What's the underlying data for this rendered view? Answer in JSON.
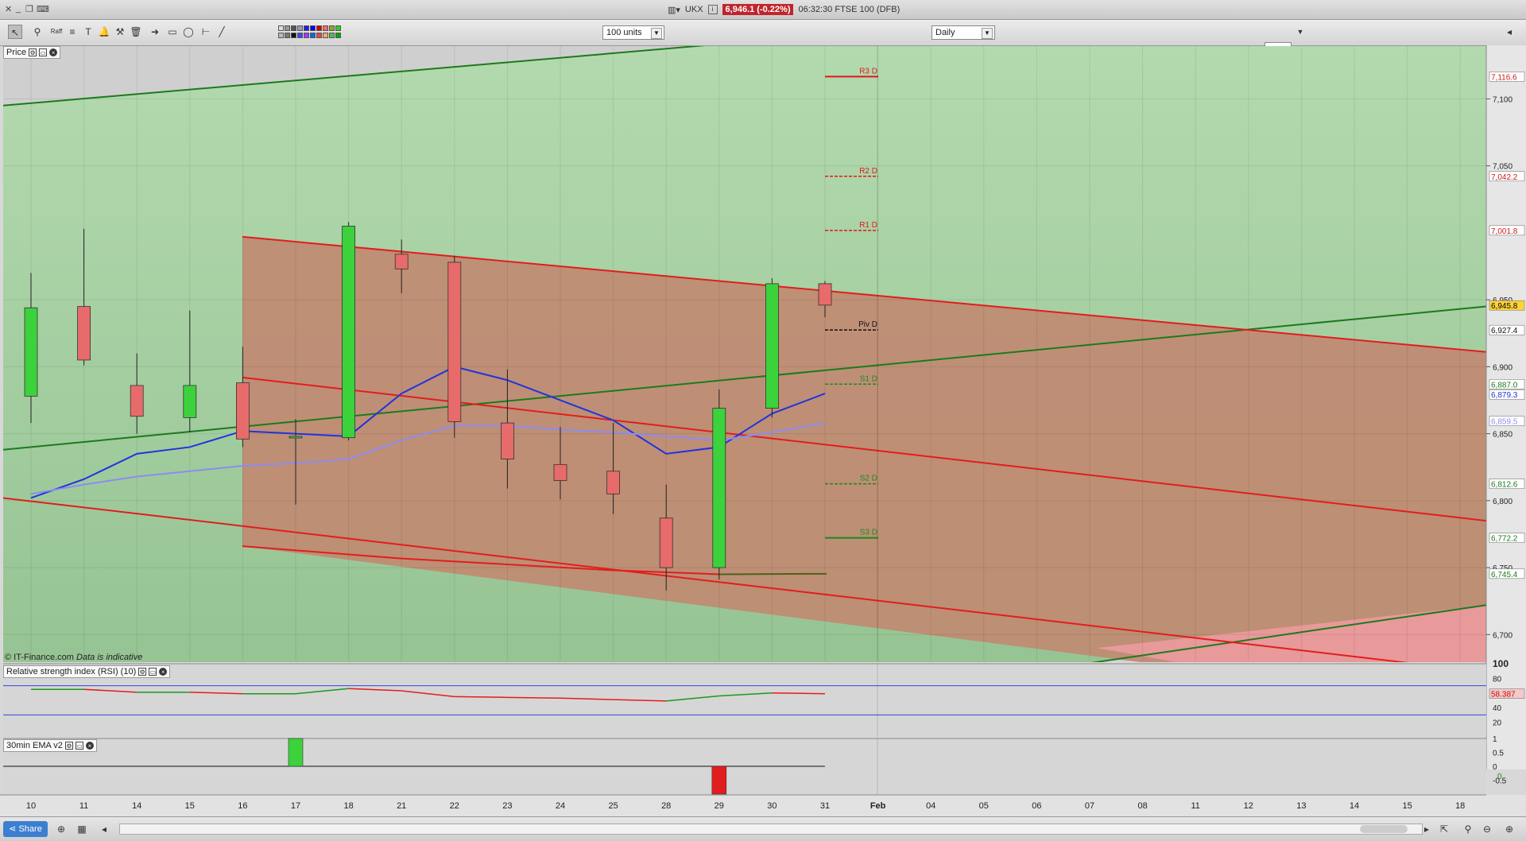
{
  "window": {
    "symbol": "UKX",
    "price_badge": "6,946.1 (-0.22%)",
    "time_label": "06:32:30 FTSE 100 (DFB)"
  },
  "toolbar": {
    "units_select": "100 units",
    "period_select": "Daily",
    "raff_label": "Raff"
  },
  "panels": {
    "price_label": "Price",
    "rsi_label": "Relative strength index (RSI) (10)",
    "ema_label": "30min EMA v2",
    "watermark_source": "© IT-Finance.com",
    "watermark_note": "Data is indicative"
  },
  "bottom": {
    "share_label": "Share"
  },
  "colors": {
    "up": "#3cd23c",
    "down": "#e86b6b",
    "channel_green": "#1c7a1c",
    "channel_red": "#e21d1d",
    "ma_fast": "#2233dd",
    "ma_slow": "#8c8cf0"
  },
  "chart_data": [
    {
      "type": "candlestick",
      "x": [
        "10",
        "11",
        "14",
        "15",
        "16",
        "17",
        "18",
        "21",
        "22",
        "23",
        "24",
        "25",
        "28",
        "29",
        "30",
        "31",
        "Feb",
        "04",
        "05",
        "06",
        "07",
        "08",
        "11",
        "12",
        "13",
        "14",
        "15",
        "18"
      ],
      "ohlc": [
        {
          "d": "10",
          "o": 6878,
          "h": 6920,
          "l": 6858,
          "c": 6944,
          "hi": 6970
        },
        {
          "d": "11",
          "o": 6945,
          "h": 7003,
          "l": 6901,
          "c": 6905
        },
        {
          "d": "14",
          "o": 6886,
          "h": 6910,
          "l": 6850,
          "c": 6863
        },
        {
          "d": "15",
          "o": 6862,
          "h": 6942,
          "l": 6851,
          "c": 6886
        },
        {
          "d": "16",
          "o": 6888,
          "h": 6915,
          "l": 6840,
          "c": 6846
        },
        {
          "d": "17",
          "o": 6848,
          "h": 6861,
          "l": 6797,
          "c": 6848
        },
        {
          "d": "18",
          "o": 6847,
          "h": 7008,
          "l": 6845,
          "c": 7005
        },
        {
          "d": "21",
          "o": 6984,
          "h": 6995,
          "l": 6955,
          "c": 6973
        },
        {
          "d": "22",
          "o": 6978,
          "h": 6983,
          "l": 6847,
          "c": 6859
        },
        {
          "d": "23",
          "o": 6858,
          "h": 6898,
          "l": 6809,
          "c": 6831
        },
        {
          "d": "24",
          "o": 6827,
          "h": 6855,
          "l": 6801,
          "c": 6815
        },
        {
          "d": "25",
          "o": 6822,
          "h": 6858,
          "l": 6790,
          "c": 6805
        },
        {
          "d": "28",
          "o": 6787,
          "h": 6812,
          "l": 6733,
          "c": 6750
        },
        {
          "d": "29",
          "o": 6750,
          "h": 6883,
          "l": 6741,
          "c": 6869
        },
        {
          "d": "30",
          "o": 6869,
          "h": 6966,
          "l": 6862,
          "c": 6962
        },
        {
          "d": "31",
          "o": 6962,
          "h": 6964,
          "l": 6937,
          "c": 6946
        }
      ],
      "ma_fast": [
        6802,
        6816,
        6835,
        6840,
        6852,
        6850,
        6848,
        6880,
        6900,
        6890,
        6875,
        6860,
        6835,
        6840,
        6865,
        6880
      ],
      "ma_slow": [
        6805,
        6812,
        6818,
        6822,
        6826,
        6828,
        6831,
        6845,
        6856,
        6856,
        6853,
        6851,
        6848,
        6845,
        6851,
        6858
      ],
      "pivots": [
        {
          "name": "R3 D",
          "value": 7116.6,
          "label": "7,116.6"
        },
        {
          "name": "R2 D",
          "value": 7042.2,
          "label": "7,042.2"
        },
        {
          "name": "R1 D",
          "value": 7001.8,
          "label": "7,001.8"
        },
        {
          "name": "Piv D",
          "value": 6927.4,
          "label": "6,927.4"
        },
        {
          "name": "S1 D",
          "value": 6887.0,
          "label": "6,887.0"
        },
        {
          "name": "S2 D",
          "value": 6812.6,
          "label": "6,812.6"
        },
        {
          "name": "S3 D",
          "value": 6772.2,
          "label": "6,772.2"
        }
      ],
      "last_price": {
        "value": 6945.8,
        "label": "6,945.8"
      },
      "ma_fast_last": {
        "value": 6879.3,
        "label": "6,879.3"
      },
      "ma_slow_last": {
        "value": 6859.5,
        "label": "6,859.5"
      },
      "floor_last": {
        "value": 6745.4,
        "label": "6,745.4"
      },
      "y_ticks": [
        "7,100",
        "7,050",
        "6,950",
        "6,900",
        "6,850",
        "6,800",
        "6,750",
        "6,700"
      ],
      "y_tick_values": [
        7100,
        7050,
        6950,
        6900,
        6850,
        6800,
        6750,
        6700
      ],
      "ylim": [
        6680,
        7140
      ]
    },
    {
      "type": "line",
      "title": "Relative strength index (RSI) (10)",
      "values": [
        65,
        65,
        61,
        61,
        59,
        59,
        66,
        63,
        55,
        54,
        53,
        51,
        49,
        56,
        60,
        59
      ],
      "last_label": "58.387",
      "y_ticks": [
        "100",
        "80",
        "60",
        "40",
        "20"
      ],
      "y_tick_values": [
        100,
        80,
        60,
        40,
        20
      ],
      "ylim": [
        0,
        100
      ]
    },
    {
      "type": "bar",
      "title": "30min EMA v2",
      "values": [
        0,
        0,
        0,
        0,
        0,
        1,
        0,
        0,
        0,
        0,
        0,
        0,
        0,
        -1,
        0,
        0
      ],
      "last_label": "0",
      "y_ticks": [
        "1",
        "0.5",
        "0",
        "-0.5"
      ],
      "y_tick_values": [
        1,
        0.5,
        0,
        -0.5
      ],
      "ylim": [
        -1,
        1
      ]
    }
  ]
}
